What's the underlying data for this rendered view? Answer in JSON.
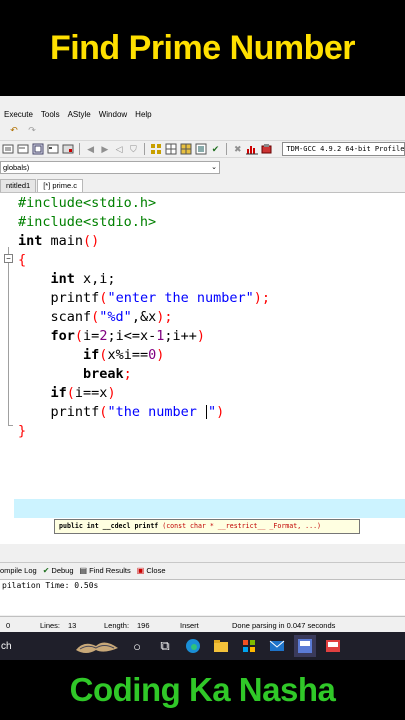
{
  "banner": {
    "top_title": "Find Prime Number",
    "bottom_title": "Coding Ka Nasha",
    "top_color": "#ffe000",
    "bottom_color": "#30c828"
  },
  "menu": [
    "Execute",
    "Tools",
    "AStyle",
    "Window",
    "Help"
  ],
  "toolbar": {
    "compiler": "TDM-GCC 4.9.2 64-bit Profile"
  },
  "scope": {
    "value": "globals)"
  },
  "tabs": [
    {
      "label": "ntitled1",
      "active": false
    },
    {
      "label": "[*] prime.c",
      "active": true
    }
  ],
  "code": {
    "line1": "#include<stdio.h>",
    "line2": "#include<stdio.h>",
    "line3_kw": "int",
    "line3_rest": " main",
    "line4": "{",
    "line5_kw": "int",
    "line5_rest": " x,i;",
    "line6_fn": "printf",
    "line6_str": "\"enter the number\"",
    "line7_fn": "scanf",
    "line7_str": "\"%d\"",
    "line7_rest": ",&x",
    "line8_kw": "for",
    "line8_a": "i=",
    "line8_n1": "2",
    "line8_b": ";i<=x-",
    "line8_n2": "1",
    "line8_c": ";i++",
    "line9_kw": "if",
    "line9_a": "x%i==",
    "line9_n": "0",
    "line10_kw": "break",
    "line11_kw": "if",
    "line11_a": "i==x",
    "line12_fn": "printf",
    "line12_str_a": "\"the number ",
    "line12_str_b": "\"",
    "line13": "}"
  },
  "tooltip": {
    "prefix": "public int __cdecl ",
    "fn": "printf",
    "params": " (const char * __restrict__ _Format, ...)"
  },
  "bottom_tabs": [
    "ompile Log",
    "Debug",
    "Find Results",
    "Close"
  ],
  "log": {
    "text": "pilation Time: 0.50s"
  },
  "status": {
    "col": "0",
    "lines": "Lines:",
    "lines_val": "13",
    "length": "Length:",
    "length_val": "196",
    "mode": "Insert",
    "message": "Done parsing in 0.047 seconds"
  },
  "taskbar": {
    "search": "ch"
  }
}
